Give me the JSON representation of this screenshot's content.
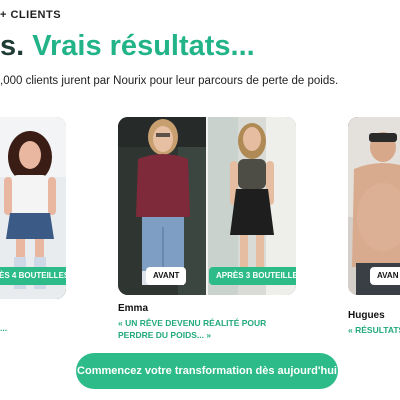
{
  "header": {
    "kicker": "+ CLIENTS",
    "headline_dark": "s.",
    "headline_accent": "Vrais résultats...",
    "subtitle": ",000 clients jurent par Nourix pour leur parcours de perte de poids."
  },
  "testimonials": [
    {
      "before_label": "",
      "after_label": "ÈS 4 BOUTEILLES",
      "name": "",
      "quote": "..."
    },
    {
      "before_label": "AVANT",
      "after_label": "APRÈS 3 BOUTEILLES",
      "name": "Emma",
      "quote": "« UN RÊVE DEVENU RÉALITÉ POUR PERDRE DU POIDS... »"
    },
    {
      "before_label": "AVAN",
      "after_label": "",
      "name": "Hugues",
      "quote": "« RÉSULTATS V"
    }
  ],
  "cta": {
    "label": "Commencez votre transformation dès aujourd'hui"
  },
  "colors": {
    "accent": "#2dbb8a",
    "accent_text": "#22b488",
    "headline_dark": "#1f3b36"
  }
}
